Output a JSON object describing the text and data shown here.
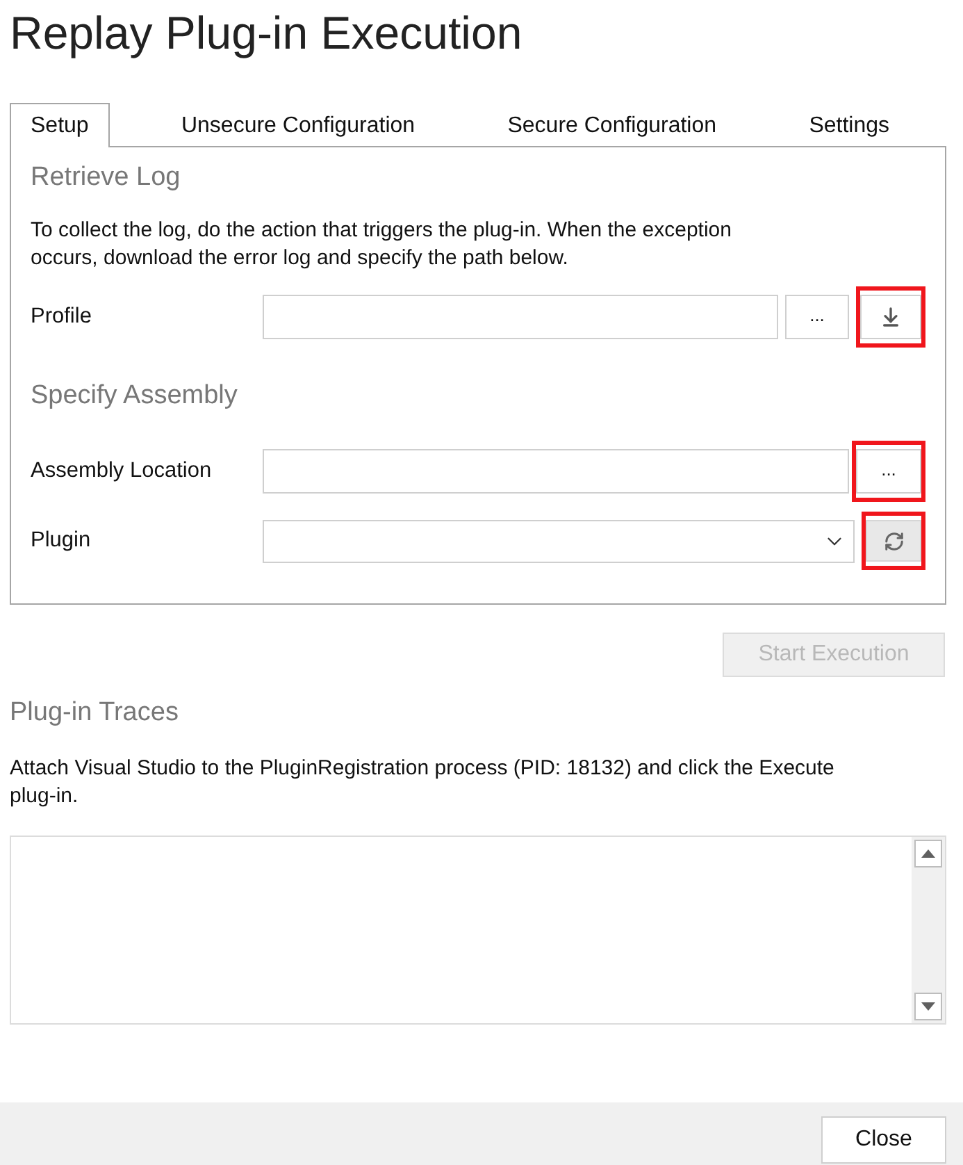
{
  "window": {
    "title": "Replay Plug-in Execution"
  },
  "tabs": [
    {
      "label": "Setup",
      "selected": true
    },
    {
      "label": "Unsecure Configuration",
      "selected": false
    },
    {
      "label": "Secure Configuration",
      "selected": false
    },
    {
      "label": "Settings",
      "selected": false
    }
  ],
  "retrieve_log": {
    "heading": "Retrieve Log",
    "instructions": "To collect the log, do the action that triggers the plug-in. When the exception occurs, download the error log and specify the path below.",
    "profile": {
      "label": "Profile",
      "browse_button": {
        "label": "..."
      },
      "download_button": {
        "highlighted": true
      }
    }
  },
  "specify_assembly": {
    "heading": "Specify Assembly",
    "assembly_location": {
      "label": "Assembly Location",
      "browse_button": {
        "label": "...",
        "highlighted": true
      }
    },
    "plugin": {
      "label": "Plugin",
      "refresh_button": {
        "highlighted": true
      }
    }
  },
  "start_execution": {
    "label": "Start Execution",
    "disabled": true
  },
  "plugin_traces": {
    "heading": "Plug-in Traces",
    "instructions": "Attach Visual Studio to the PluginRegistration process (PID: 18132) and click the Execute plug-in."
  },
  "footer": {
    "close_button": {
      "label": "Close"
    }
  }
}
